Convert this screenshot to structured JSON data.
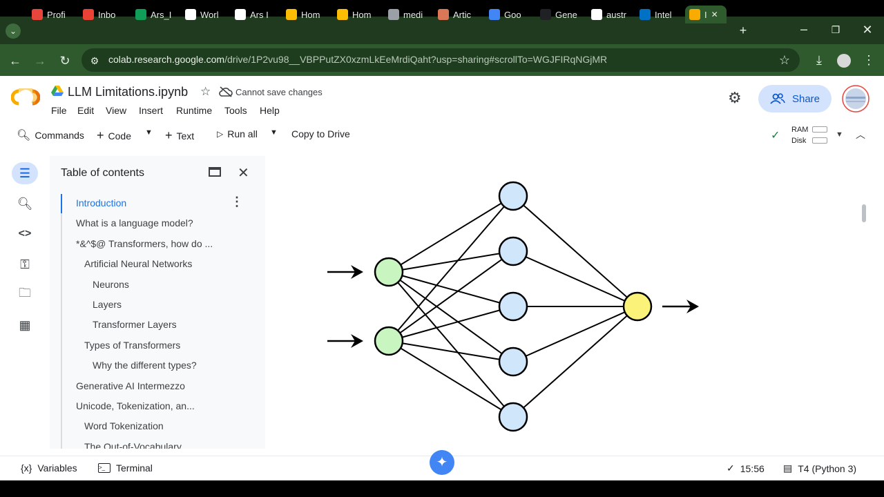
{
  "browser": {
    "tabs": [
      {
        "label": "Profi",
        "icon": "profile-icon",
        "color": "#e8453c"
      },
      {
        "label": "Inbo",
        "icon": "gmail-icon",
        "color": "#ea4335"
      },
      {
        "label": "Ars_I",
        "icon": "sheets-icon",
        "color": "#0f9d58"
      },
      {
        "label": "Worl",
        "icon": "doc-icon",
        "color": "#ffffff"
      },
      {
        "label": "Ars I",
        "icon": "doc-icon",
        "color": "#ffffff"
      },
      {
        "label": "Hom",
        "icon": "drive-icon",
        "color": "#fbbc04"
      },
      {
        "label": "Hom",
        "icon": "drive-icon",
        "color": "#fbbc04"
      },
      {
        "label": "medi",
        "icon": "globe-icon",
        "color": "#9aa0a6"
      },
      {
        "label": "Artic",
        "icon": "claude-icon",
        "color": "#d97757"
      },
      {
        "label": "Goo",
        "icon": "gemini-icon",
        "color": "#4285f4"
      },
      {
        "label": "Gene",
        "icon": "openai-icon",
        "color": "#202124"
      },
      {
        "label": "austr",
        "icon": "google-icon",
        "color": "#ffffff"
      },
      {
        "label": "Intel",
        "icon": "intel-icon",
        "color": "#0071c5"
      },
      {
        "label": "I",
        "icon": "colab-icon",
        "color": "#f9ab00"
      }
    ],
    "url_host": "colab.research.google.com",
    "url_path": "/drive/1P2vu98__VBPPutZX0xzmLkEeMrdiQaht?usp=sharing#scrollTo=WGJFIRqNGjMR"
  },
  "colab": {
    "notebook_title": "LLM Limitations.ipynb",
    "save_status": "Cannot save changes",
    "menu": [
      "File",
      "Edit",
      "View",
      "Insert",
      "Runtime",
      "Tools",
      "Help"
    ],
    "share_label": "Share",
    "toolbar": {
      "commands": "Commands",
      "code": "Code",
      "text": "Text",
      "run_all": "Run all",
      "copy_to_drive": "Copy to Drive",
      "ram": "RAM",
      "disk": "Disk"
    }
  },
  "toc": {
    "title": "Table of contents",
    "items": [
      {
        "label": "Introduction",
        "level": 1,
        "active": true
      },
      {
        "label": "What is a language model?",
        "level": 1
      },
      {
        "label": "*&^$@ Transformers, how do ...",
        "level": 1
      },
      {
        "label": "Artificial Neural Networks",
        "level": 2
      },
      {
        "label": "Neurons",
        "level": 3
      },
      {
        "label": "Layers",
        "level": 3
      },
      {
        "label": "Transformer Layers",
        "level": 3
      },
      {
        "label": "Types of Transformers",
        "level": 2
      },
      {
        "label": "Why the different types?",
        "level": 3
      },
      {
        "label": "Generative AI Intermezzo",
        "level": 1
      },
      {
        "label": "Unicode, Tokenization, an...",
        "level": 1
      },
      {
        "label": "Word Tokenization",
        "level": 2
      },
      {
        "label": "The Out-of-Vocabulary",
        "level": 2
      }
    ]
  },
  "status": {
    "variables": "Variables",
    "terminal": "Terminal",
    "time": "15:56",
    "runtime": "T4 (Python 3)"
  },
  "colors": {
    "input_node": "#c8f5c0",
    "hidden_node": "#cfe6fb",
    "output_node": "#fbf27a",
    "accent": "#1a73e8"
  }
}
